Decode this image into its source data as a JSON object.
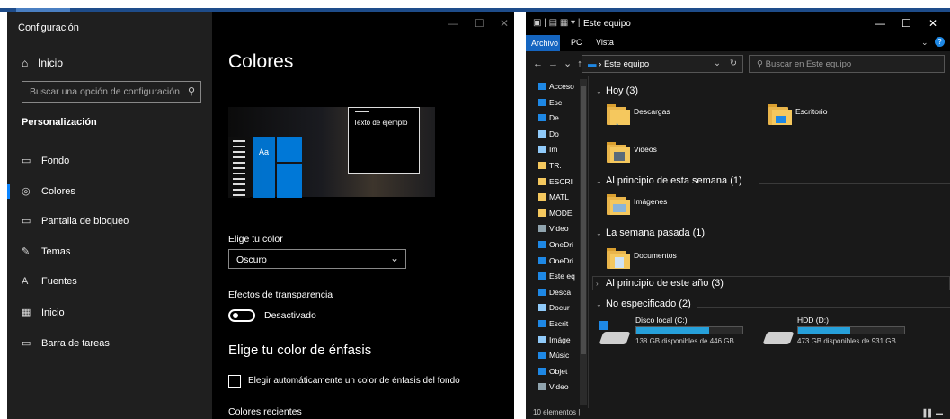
{
  "settings": {
    "title": "Configuración",
    "home": "Inicio",
    "search_placeholder": "Buscar una opción de configuración",
    "section": "Personalización",
    "nav": [
      "Fondo",
      "Colores",
      "Pantalla de bloqueo",
      "Temas",
      "Fuentes",
      "Inicio",
      "Barra de tareas"
    ],
    "active_nav": "Colores",
    "page_title": "Colores",
    "preview_text": "Texto de ejemplo",
    "preview_tile": "Aa",
    "choose_color_label": "Elige tu color",
    "choose_color_value": "Oscuro",
    "transparency_label": "Efectos de transparencia",
    "transparency_value": "Desactivado",
    "accent_heading": "Elige tu color de énfasis",
    "auto_accent_label": "Elegir automáticamente un color de énfasis del fondo",
    "recent_colors": "Colores recientes",
    "accent_color": "#0078d7"
  },
  "explorer": {
    "title": "Este equipo",
    "ribbon_tabs": [
      "Archivo",
      "PC",
      "Vista"
    ],
    "address": "Este equipo",
    "search_placeholder": "Buscar en Este equipo",
    "tree": [
      {
        "label": "Acceso",
        "icon": "star-icon",
        "color": "#1e88e5"
      },
      {
        "label": "Esc",
        "icon": "desktop-icon",
        "color": "#1e88e5"
      },
      {
        "label": "De",
        "icon": "download-icon",
        "color": "#1e88e5"
      },
      {
        "label": "Do",
        "icon": "document-icon",
        "color": "#90caf9"
      },
      {
        "label": "Im",
        "icon": "pictures-icon",
        "color": "#90caf9"
      },
      {
        "label": "TR.",
        "icon": "folder-icon",
        "color": "#f5c85e"
      },
      {
        "label": "ESCRI",
        "icon": "folder-icon",
        "color": "#f5c85e"
      },
      {
        "label": "MATL",
        "icon": "folder-icon",
        "color": "#f5c85e"
      },
      {
        "label": "MODE",
        "icon": "folder-icon",
        "color": "#f5c85e"
      },
      {
        "label": "Video",
        "icon": "video-icon",
        "color": "#90a4ae"
      },
      {
        "label": "OneDri",
        "icon": "cloud-icon",
        "color": "#1e88e5"
      },
      {
        "label": "OneDri",
        "icon": "cloud-icon",
        "color": "#1e88e5"
      },
      {
        "label": "Este eq",
        "icon": "pc-icon",
        "color": "#1e88e5"
      },
      {
        "label": "Desca",
        "icon": "download-icon",
        "color": "#1e88e5"
      },
      {
        "label": "Docur",
        "icon": "document-icon",
        "color": "#90caf9"
      },
      {
        "label": "Escrit",
        "icon": "desktop-icon",
        "color": "#1e88e5"
      },
      {
        "label": "Imáge",
        "icon": "pictures-icon",
        "color": "#90caf9"
      },
      {
        "label": "Músic",
        "icon": "music-icon",
        "color": "#1e88e5"
      },
      {
        "label": "Objet",
        "icon": "objects-icon",
        "color": "#1e88e5"
      },
      {
        "label": "Video",
        "icon": "video-icon",
        "color": "#90a4ae"
      }
    ],
    "groups": {
      "today": "Hoy (3)",
      "week": "Al principio de esta semana (1)",
      "last_week": "La semana pasada (1)",
      "year": "Al principio de este año (3)",
      "unspecified": "No especificado (2)"
    },
    "items": {
      "descargas": "Descargas",
      "escritorio": "Escritorio",
      "videos": "Videos",
      "imagenes": "Imágenes",
      "documentos": "Documentos"
    },
    "drives": [
      {
        "name": "Disco local (C:)",
        "free": "138 GB disponibles de 446 GB",
        "used_fraction": 0.69
      },
      {
        "name": "HDD (D:)",
        "free": "473 GB disponibles de 931 GB",
        "used_fraction": 0.49
      }
    ],
    "status": "10 elementos"
  }
}
